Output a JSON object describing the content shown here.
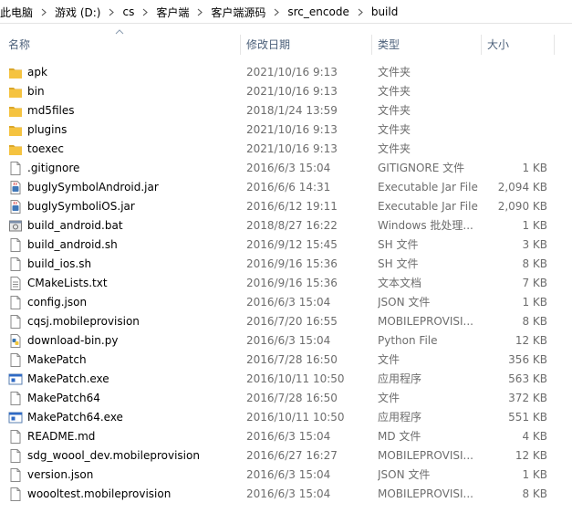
{
  "breadcrumb": [
    "此电脑",
    "游戏 (D:)",
    "cs",
    "客户端",
    "客户端源码",
    "src_encode",
    "build"
  ],
  "columns": {
    "name": "名称",
    "date": "修改日期",
    "type": "类型",
    "size": "大小"
  },
  "colors": {
    "folder": "#f5c340",
    "folder_dark": "#dba72a",
    "header_text": "#4c607a",
    "meta_text": "#6d6d6d"
  },
  "files": [
    {
      "name": "apk",
      "date": "2021/10/16 9:13",
      "type": "文件夹",
      "size": "",
      "icon": "folder-icon"
    },
    {
      "name": "bin",
      "date": "2021/10/16 9:13",
      "type": "文件夹",
      "size": "",
      "icon": "folder-icon"
    },
    {
      "name": "md5files",
      "date": "2018/1/24 13:59",
      "type": "文件夹",
      "size": "",
      "icon": "folder-icon"
    },
    {
      "name": "plugins",
      "date": "2021/10/16 9:13",
      "type": "文件夹",
      "size": "",
      "icon": "folder-icon"
    },
    {
      "name": "toexec",
      "date": "2021/10/16 9:13",
      "type": "文件夹",
      "size": "",
      "icon": "folder-icon"
    },
    {
      "name": ".gitignore",
      "date": "2016/6/3 15:04",
      "type": "GITIGNORE 文件",
      "size": "1 KB",
      "icon": "file-icon"
    },
    {
      "name": "buglySymbolAndroid.jar",
      "date": "2016/6/6 14:31",
      "type": "Executable Jar File",
      "size": "2,094 KB",
      "icon": "jar-icon"
    },
    {
      "name": "buglySymboliOS.jar",
      "date": "2016/6/12 19:11",
      "type": "Executable Jar File",
      "size": "2,090 KB",
      "icon": "jar-icon"
    },
    {
      "name": "build_android.bat",
      "date": "2018/8/27 16:22",
      "type": "Windows 批处理...",
      "size": "1 KB",
      "icon": "batch-icon"
    },
    {
      "name": "build_android.sh",
      "date": "2016/9/12 15:45",
      "type": "SH 文件",
      "size": "3 KB",
      "icon": "file-icon"
    },
    {
      "name": "build_ios.sh",
      "date": "2016/9/16 15:36",
      "type": "SH 文件",
      "size": "8 KB",
      "icon": "file-icon"
    },
    {
      "name": "CMakeLists.txt",
      "date": "2016/9/16 15:36",
      "type": "文本文档",
      "size": "7 KB",
      "icon": "text-file-icon"
    },
    {
      "name": "config.json",
      "date": "2016/6/3 15:04",
      "type": "JSON 文件",
      "size": "1 KB",
      "icon": "file-icon"
    },
    {
      "name": "cqsj.mobileprovision",
      "date": "2016/7/20 16:55",
      "type": "MOBILEPROVISI...",
      "size": "8 KB",
      "icon": "file-icon"
    },
    {
      "name": "download-bin.py",
      "date": "2016/6/3 15:04",
      "type": "Python File",
      "size": "12 KB",
      "icon": "python-icon"
    },
    {
      "name": "MakePatch",
      "date": "2016/7/28 16:50",
      "type": "文件",
      "size": "356 KB",
      "icon": "file-icon"
    },
    {
      "name": "MakePatch.exe",
      "date": "2016/10/11 10:50",
      "type": "应用程序",
      "size": "563 KB",
      "icon": "exe-icon"
    },
    {
      "name": "MakePatch64",
      "date": "2016/7/28 16:50",
      "type": "文件",
      "size": "372 KB",
      "icon": "file-icon"
    },
    {
      "name": "MakePatch64.exe",
      "date": "2016/10/11 10:50",
      "type": "应用程序",
      "size": "551 KB",
      "icon": "exe-icon"
    },
    {
      "name": "README.md",
      "date": "2016/6/3 15:04",
      "type": "MD 文件",
      "size": "4 KB",
      "icon": "file-icon"
    },
    {
      "name": "sdg_woool_dev.mobileprovision",
      "date": "2016/6/27 16:27",
      "type": "MOBILEPROVISI...",
      "size": "12 KB",
      "icon": "file-icon"
    },
    {
      "name": "version.json",
      "date": "2016/6/3 15:04",
      "type": "JSON 文件",
      "size": "1 KB",
      "icon": "file-icon"
    },
    {
      "name": "woooltest.mobileprovision",
      "date": "2016/6/3 15:04",
      "type": "MOBILEPROVISI...",
      "size": "8 KB",
      "icon": "file-icon"
    }
  ]
}
